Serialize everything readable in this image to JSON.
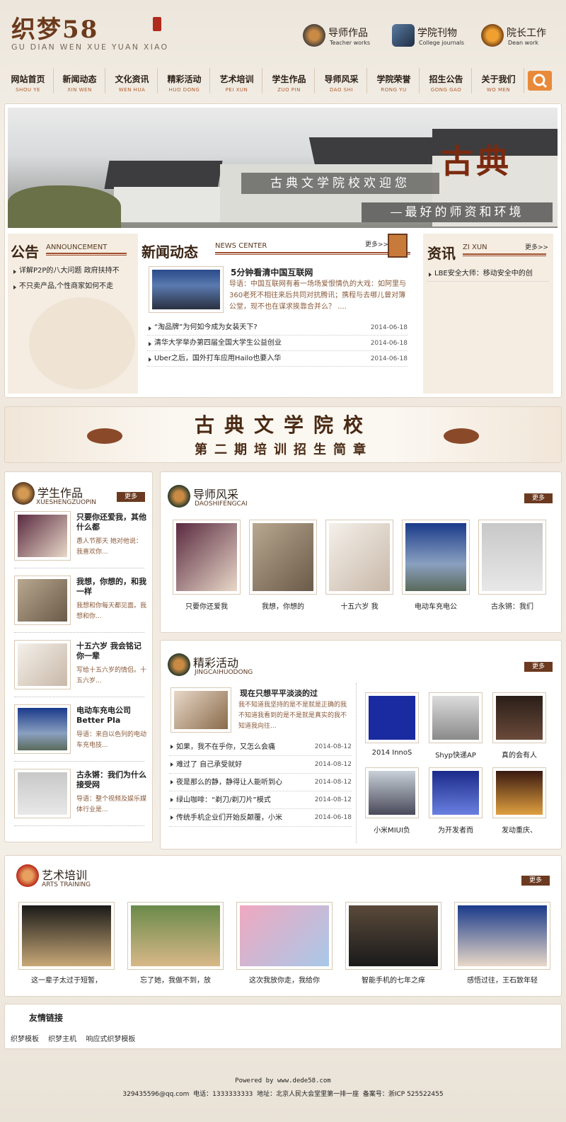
{
  "header": {
    "logo_title": "织梦58",
    "logo_sub": "GU DIAN WEN XUE YUAN XIAO",
    "links": [
      {
        "cn": "导师作品",
        "en": "Teacher works",
        "icon": "medal-icon"
      },
      {
        "cn": "学院刊物",
        "en": "College journals",
        "icon": "book-icon"
      },
      {
        "cn": "院长工作",
        "en": "Dean work",
        "icon": "bowl-icon"
      }
    ]
  },
  "nav": [
    {
      "cn": "网站首页",
      "en": "SHOU YE"
    },
    {
      "cn": "新闻动态",
      "en": "XIN WEN"
    },
    {
      "cn": "文化资讯",
      "en": "WEN HUA"
    },
    {
      "cn": "精彩活动",
      "en": "HUO DONG"
    },
    {
      "cn": "艺术培训",
      "en": "PEI XUN"
    },
    {
      "cn": "学生作品",
      "en": "ZUO PIN"
    },
    {
      "cn": "导师风采",
      "en": "DAO SHI"
    },
    {
      "cn": "学院荣誉",
      "en": "RONG YU"
    },
    {
      "cn": "招生公告",
      "en": "GONG GAO"
    },
    {
      "cn": "关于我们",
      "en": "WO MEN"
    }
  ],
  "banner": {
    "welcome": "古典文学院校欢迎您",
    "big": "古典",
    "slogan": "—最好的师资和环境"
  },
  "announcement": {
    "title": "公告",
    "sub": "ANNOUNCEMENT",
    "items": [
      "详解P2P的八大问题 政府扶持不",
      "不只卖产品,个性商家如何不走"
    ]
  },
  "news": {
    "title": "新闻动态",
    "sub": "NEWS CENTER",
    "more": "更多>>",
    "featured": {
      "title": "5分钟看清中国互联网",
      "summary": "导语：中国互联网有着一场场爱恨情仇的大戏：如阿里与360老死不相往来后共同对抗腾讯；携程与去哪儿曾对簿公堂，现不也在谋求挨靠合并么？ ...."
    },
    "items": [
      {
        "title": "“淘品牌”为何如今成为女装天下?",
        "date": "2014-06-18"
      },
      {
        "title": "清华大学举办第四届全国大学生公益创业",
        "date": "2014-06-18"
      },
      {
        "title": "Uber之后，国外打车应用Hailo也要入华",
        "date": "2014-06-18"
      }
    ]
  },
  "zixun": {
    "title": "资讯",
    "sub": "ZI XUN",
    "more": "更多>>",
    "items": [
      "LBE安全大师：移动安全中的创"
    ]
  },
  "recruit": {
    "line1": "古典文学院校",
    "line2": "第二期培训招生简章"
  },
  "students": {
    "title": "学生作品",
    "sub": "XUESHENGZUOPIN",
    "more": "更多",
    "items": [
      {
        "title": "只要你还爱我，其他什么都",
        "desc": "愚人节那天 她对他说：我喜欢你..."
      },
      {
        "title": "我想，你想的，和我一样",
        "desc": "我想和你每天都见面。我想和你..."
      },
      {
        "title": "十五六岁 我会铭记你一辈",
        "desc": "写给十五六岁的情侣。十五六岁..."
      },
      {
        "title": "电动车充电公司 Better Pla",
        "desc": "导语：来自以色列的电动车充电技..."
      },
      {
        "title": "古永锵：我们为什么接受网",
        "desc": "导语：整个视频及娱乐媒体行业是..."
      }
    ]
  },
  "teachers": {
    "title": "导师风采",
    "sub": "DAOSHIFENGCAI",
    "more": "更多",
    "items": [
      "只要你还爱我",
      "我想，你想的",
      "十五六岁 我",
      "电动车充电公",
      "古永锵：我们"
    ]
  },
  "activities": {
    "title": "精彩活动",
    "sub": "JINGCAIHUODONG",
    "more": "更多",
    "featured": {
      "title": "现在只想平平淡淡的过",
      "summary": "我不知道我坚持的是不是就是正确的我不知道我看到的是不是就是真实的我不知道我向往..."
    },
    "items": [
      {
        "title": "如果，我不在乎你，又怎么会痛",
        "date": "2014-08-12"
      },
      {
        "title": "难过了 自己承受就好",
        "date": "2014-08-12"
      },
      {
        "title": "夜是那么的静，静得让人能听到心",
        "date": "2014-08-12"
      },
      {
        "title": "绿山咖啡：“剃刀/剃刀片”模式",
        "date": "2014-08-12"
      },
      {
        "title": "传统手机企业们开始反颠覆，小米",
        "date": "2014-06-18"
      }
    ],
    "thumbs": [
      "2014 InnoS",
      "Shyp快递AP",
      "真的会有人",
      "小米MIUI负",
      "为开发者而",
      "发动重庆、"
    ]
  },
  "arts": {
    "title": "艺术培训",
    "sub": "ARTS TRAINING",
    "more": "更多",
    "items": [
      "这一辈子太过于短暂，",
      "忘了她，我做不到，放",
      "这次我放你走，我给你",
      "智能手机的七年之痒",
      "感悟过往，王石致年轻"
    ]
  },
  "links": {
    "title": "友情链接",
    "items": [
      "织梦模板",
      "织梦主机",
      "响应式织梦模板"
    ]
  },
  "footer": {
    "powered": "Powered by www.dede58.com",
    "contact": "329435596@qq.com  电话：1333333333  地址：北京人民大会堂里第一排一座  备案号：浙ICP 525522455"
  }
}
